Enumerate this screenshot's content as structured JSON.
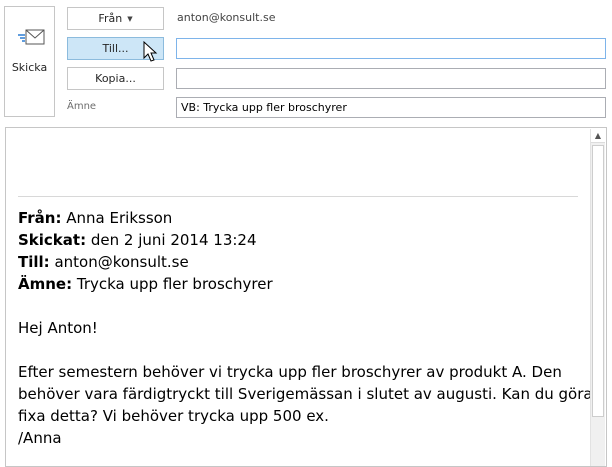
{
  "send": {
    "label": "Skicka"
  },
  "header": {
    "from_button": "Från",
    "from_address": "anton@konsult.se",
    "to_button": "Till...",
    "to_value": "",
    "cc_button": "Kopia...",
    "cc_value": "",
    "subject_label": "Ämne",
    "subject_value": "VB: Trycka upp fler broschyrer"
  },
  "body": {
    "quoted_header": [
      {
        "label": "Från:",
        "value": "Anna Eriksson"
      },
      {
        "label": "Skickat:",
        "value": "den 2 juni 2014 13:24"
      },
      {
        "label": "Till:",
        "value": "anton@konsult.se"
      },
      {
        "label": "Ämne:",
        "value": "Trycka upp fler broschyrer"
      }
    ],
    "greeting": "Hej Anton!",
    "lines": [
      "Efter semestern behöver vi trycka upp fler broschyrer av produkt A. Den",
      "behöver vara färdigtryckt till Sverigemässan i slutet av augusti. Kan du göra",
      "fixa detta? Vi behöver trycka upp 500 ex.",
      "/Anna"
    ]
  },
  "colors": {
    "active_button": "#cde6f7",
    "border": "#c6c6c6",
    "envelope_blue": "#2b7cd3"
  },
  "icons": {
    "send": "envelope-send-icon",
    "dropdown": "caret-down-icon",
    "scroll_up": "arrow-up-icon",
    "pointer": "mouse-pointer-icon"
  }
}
